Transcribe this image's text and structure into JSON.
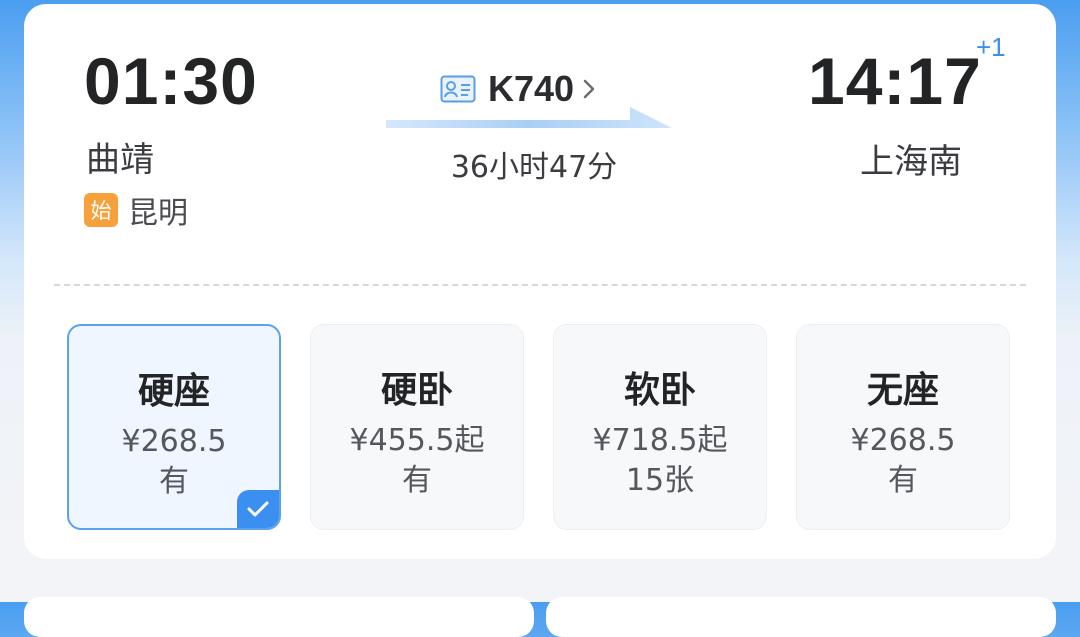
{
  "trip": {
    "departure": {
      "time": "01:30",
      "station": "曲靖"
    },
    "origin": {
      "tag": "始",
      "station": "昆明"
    },
    "train": {
      "number": "K740",
      "icon": "id-card-icon"
    },
    "duration": "36小时47分",
    "arrival": {
      "time": "14:17",
      "day_offset": "+1",
      "station": "上海南"
    }
  },
  "seats": [
    {
      "name": "硬座",
      "price": "¥268.5",
      "availability": "有",
      "selected": true
    },
    {
      "name": "硬卧",
      "price": "¥455.5起",
      "availability": "有",
      "selected": false
    },
    {
      "name": "软卧",
      "price": "¥718.5起",
      "availability": "15张",
      "selected": false
    },
    {
      "name": "无座",
      "price": "¥268.5",
      "availability": "有",
      "selected": false
    }
  ],
  "colors": {
    "accent": "#3b8ff0",
    "origin_tag": "#f6a13c",
    "plus_day": "#3d8fe8"
  }
}
